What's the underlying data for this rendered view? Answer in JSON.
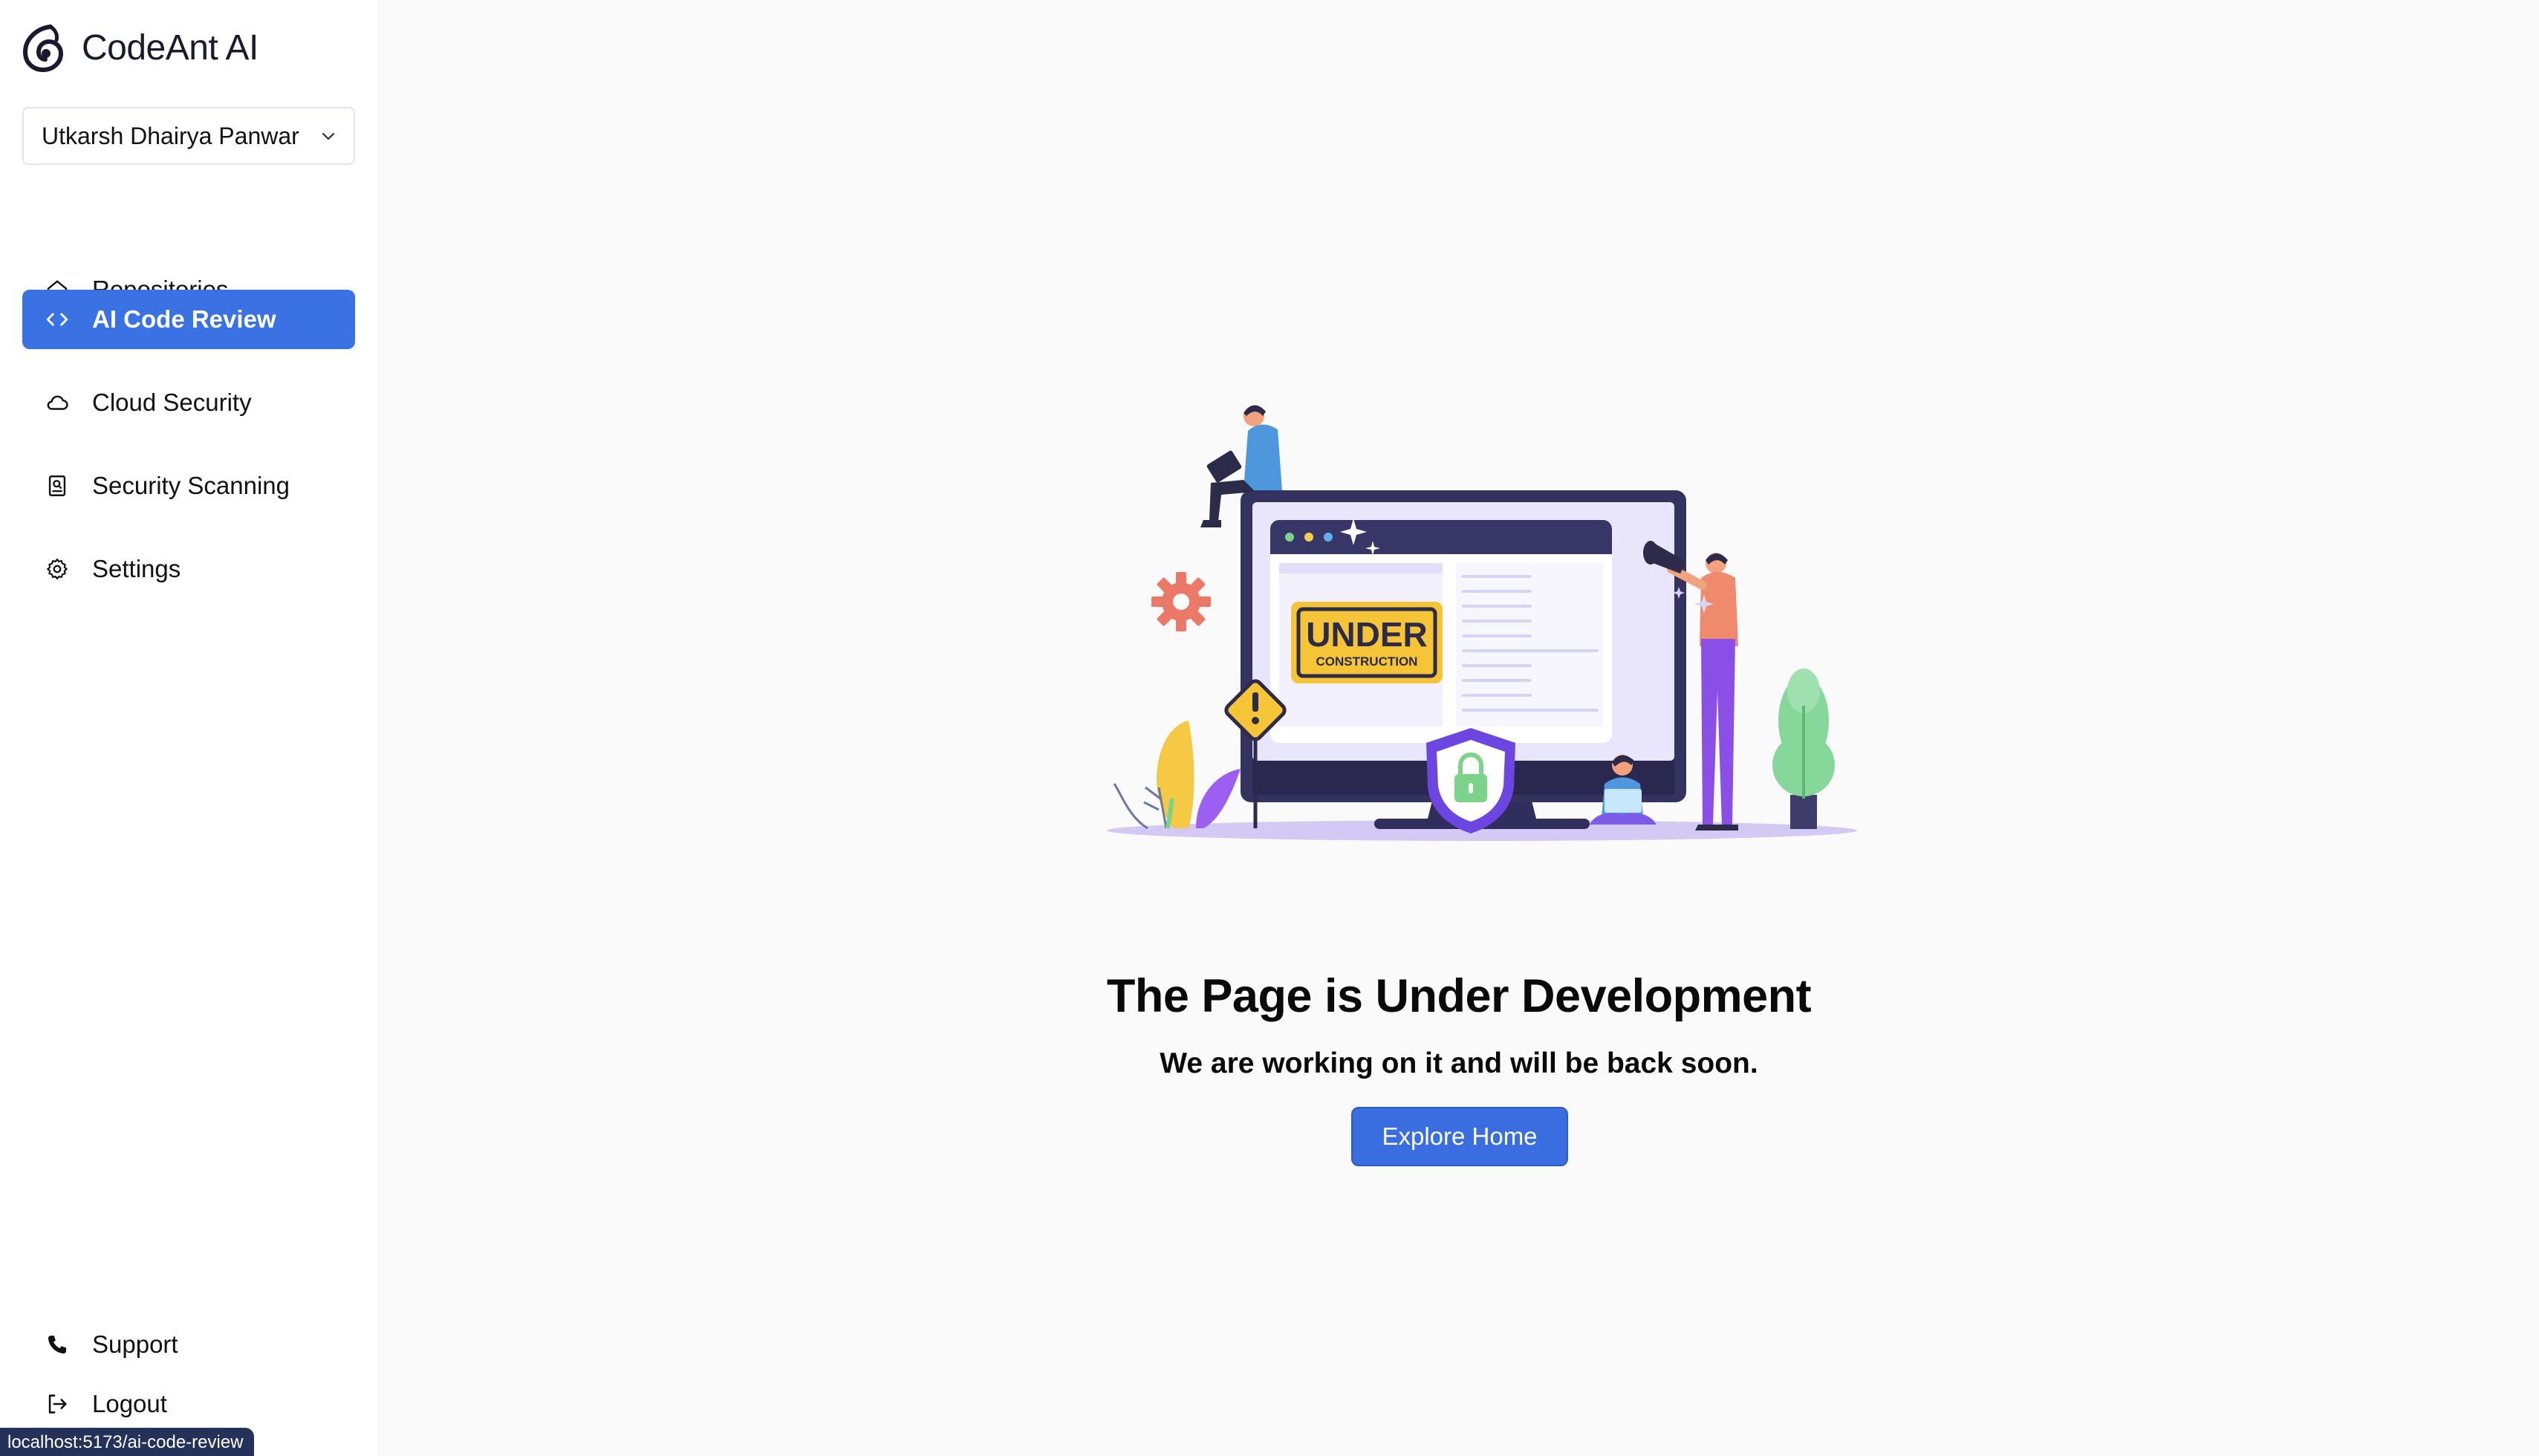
{
  "brand": {
    "name": "CodeAnt AI",
    "logo_icon": "codeant-logo-icon"
  },
  "org_selector": {
    "value": "Utkarsh Dhairya Panwar",
    "icon": "chevron-down-icon"
  },
  "sidebar": {
    "items": [
      {
        "label": "Repositories",
        "icon": "home-icon",
        "active": false
      },
      {
        "label": "AI Code Review",
        "icon": "code-icon",
        "active": true
      },
      {
        "label": "Cloud Security",
        "icon": "cloud-icon",
        "active": false
      },
      {
        "label": "Security Scanning",
        "icon": "scan-icon",
        "active": false
      },
      {
        "label": "Settings",
        "icon": "gear-icon",
        "active": false
      }
    ],
    "bottom": [
      {
        "label": "Support",
        "icon": "phone-icon"
      },
      {
        "label": "Logout",
        "icon": "logout-icon"
      }
    ],
    "active_color": "#3a72e4"
  },
  "main": {
    "illustration": {
      "sign_line1": "UNDER",
      "sign_line2": "CONSTRUCTION"
    },
    "title": "The Page is Under Development",
    "subtitle": "We are working on it and will be back soon.",
    "button_label": "Explore Home",
    "button_color": "#3a6ee0"
  },
  "status_bar": {
    "url": "localhost:5173/ai-code-review"
  }
}
